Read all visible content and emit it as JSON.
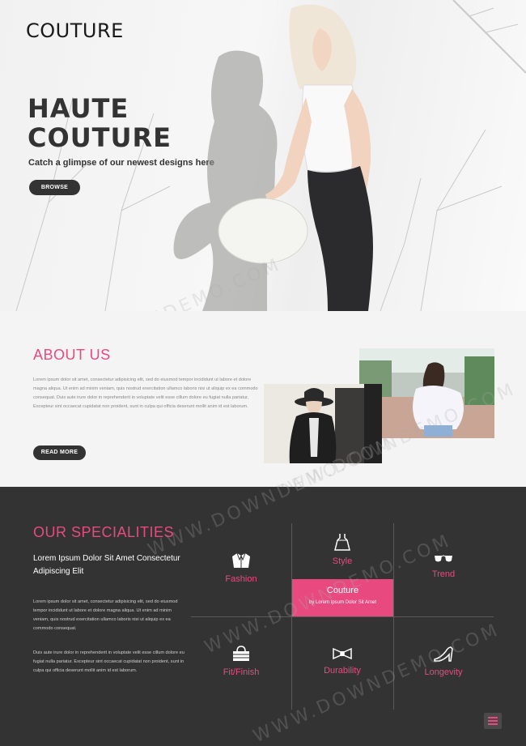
{
  "brand": {
    "logo": "COUTURE"
  },
  "hero": {
    "title_line1": "HAUTE",
    "title_line2": "COUTURE",
    "subtitle": "Catch a glimpse of our newest designs here",
    "button": "BROWSE"
  },
  "about": {
    "title": "ABOUT US",
    "text": "Lorem ipsum dolor sit amet, consectetur adipisicing elit, sed do eiusmod tempor incididunt ut labore et dolore magna aliqua. Ut enim ad minim veniam, quis nostrud exercitation ullamco laboris nisi ut aliquip ex ea commodo consequat. Duis aute irure dolor in reprehenderit in voluptate velit esse cillum dolore eu fugiat nulla pariatur. Excepteur sint occaecat cupidatat non proident, sunt in culpa qui officia deserunt mollit anim id est laborum.",
    "button": "READ MORE"
  },
  "specialities": {
    "title": "OUR SPECIALITIES",
    "subtitle": "Lorem Ipsum Dolor Sit Amet Consectetur Adipiscing Elit",
    "para1": "Lorem ipsum dolor sit amet, consectetur adipisicing elit, sed do eiusmod tempor incididunt ut labore et dolore magna aliqua. Ut enim ad minim veniam, quis nostrud exercitation ullamco laboris nisi ut aliquip ex ea commodo consequat.",
    "para2": "Duis aute irure dolor in reprehenderit in voluptate velit esse cillum dolore eu fugiat nulla pariatur. Excepteur sint occaecat cupidatat non proident, sunt in culpa qui officia deserunt mollit anim id est laborum.",
    "items": [
      {
        "label": "Fashion",
        "icon": "jacket-icon"
      },
      {
        "label": "Style",
        "icon": "dress-icon"
      },
      {
        "label": "Trend",
        "icon": "sunglasses-icon"
      },
      {
        "label": "Fit/Finish",
        "icon": "basket-icon"
      },
      {
        "label": "Durability",
        "icon": "bowtie-icon"
      },
      {
        "label": "Longevity",
        "icon": "heel-icon"
      }
    ],
    "highlight": {
      "title": "Couture",
      "subtitle": "by Lorem Ipsum Dolor Sit Amet"
    }
  },
  "watermark": "WWW.DOWNDEMO.COM",
  "colors": {
    "accent": "#e84a7f",
    "dark": "#333333",
    "light_bg": "#f4f4f4"
  },
  "menu": {
    "icon": "hamburger-icon"
  }
}
